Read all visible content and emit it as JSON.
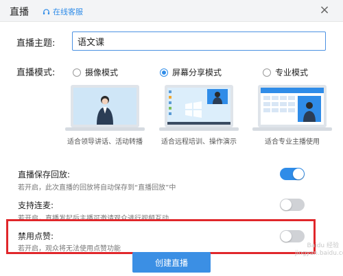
{
  "window": {
    "title": "直播",
    "support_link": "在线客服"
  },
  "form": {
    "topic_label": "直播主题:",
    "topic_value": "语文课",
    "mode_label": "直播模式:"
  },
  "modes": [
    {
      "label": "摄像模式",
      "selected": false,
      "caption": "适合领导讲话、活动转播"
    },
    {
      "label": "屏幕分享模式",
      "selected": true,
      "caption": "适合远程培训、操作演示"
    },
    {
      "label": "专业模式",
      "selected": false,
      "caption": "适合专业主播使用"
    }
  ],
  "settings": [
    {
      "title": "直播保存回放:",
      "desc": "若开启，此次直播的回放将自动保存到“直播回放”中",
      "enabled": true
    },
    {
      "title": "支持连麦:",
      "desc": "若开启，直播发起后主播可邀请观众进行视频互动",
      "enabled": false
    },
    {
      "title": "禁用点赞:",
      "desc": "若开启，观众将无法使用点赞功能",
      "enabled": false
    }
  ],
  "create_button": "创建直播",
  "watermark": {
    "line1": "Baidu 经验",
    "line2": "jingyan.baidu.com"
  },
  "colors": {
    "accent": "#2f8ce8",
    "highlight": "#e0262a"
  }
}
